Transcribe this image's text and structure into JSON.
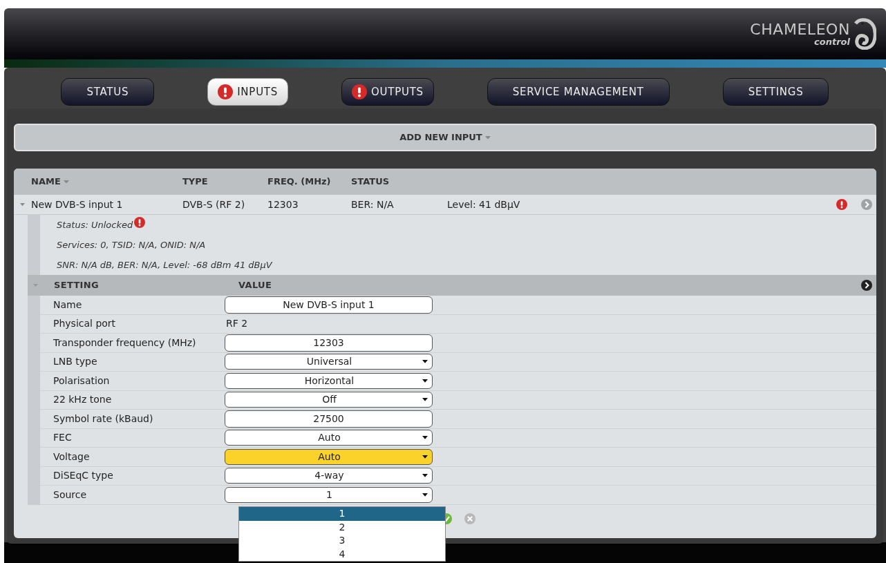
{
  "logo": {
    "brand": "CHAMELEON",
    "product": "control"
  },
  "tabs": [
    {
      "label": "STATUS",
      "selected": false,
      "alert": false
    },
    {
      "label": "INPUTS",
      "selected": true,
      "alert": true
    },
    {
      "label": "OUTPUTS",
      "selected": false,
      "alert": true
    },
    {
      "label": "SERVICE MANAGEMENT",
      "selected": false,
      "alert": false
    },
    {
      "label": "SETTINGS",
      "selected": false,
      "alert": false
    }
  ],
  "add_button": "ADD NEW INPUT",
  "table": {
    "columns": [
      "NAME",
      "TYPE",
      "FREQ. (MHz)",
      "STATUS"
    ],
    "rows": [
      {
        "expanded": true,
        "alert": true,
        "name": "New DVB-S input 1",
        "type": "DVB-S (RF 2)",
        "freq": "12303",
        "ber": "BER: N/A",
        "level": "Level: 41 dBµV",
        "details": [
          {
            "text": "Status: Unlocked",
            "alert": true
          },
          {
            "text": "Services: 0, TSID: N/A, ONID: N/A",
            "alert": false
          },
          {
            "text": "SNR: N/A dB, BER: N/A, Level: -68 dBm 41 dBµV",
            "alert": false
          }
        ],
        "settings": {
          "columns": [
            "SETTING",
            "VALUE"
          ],
          "expanded": true,
          "rows": [
            {
              "label": "Name",
              "kind": "input",
              "value": "New DVB-S input 1",
              "highlighted": false
            },
            {
              "label": "Physical port",
              "kind": "text",
              "value": "RF 2",
              "highlighted": false
            },
            {
              "label": "Transponder frequency (MHz)",
              "kind": "input",
              "value": "12303",
              "highlighted": false
            },
            {
              "label": "LNB type",
              "kind": "select",
              "value": "Universal",
              "highlighted": false
            },
            {
              "label": "Polarisation",
              "kind": "select",
              "value": "Horizontal",
              "highlighted": false
            },
            {
              "label": "22 kHz tone",
              "kind": "select",
              "value": "Off",
              "highlighted": false
            },
            {
              "label": "Symbol rate (kBaud)",
              "kind": "input",
              "value": "27500",
              "highlighted": false
            },
            {
              "label": "FEC",
              "kind": "select",
              "value": "Auto",
              "highlighted": false
            },
            {
              "label": "Voltage",
              "kind": "select",
              "value": "Auto",
              "highlighted": true
            },
            {
              "label": "DiSEqC type",
              "kind": "select",
              "value": "4-way",
              "highlighted": false
            },
            {
              "label": "Source",
              "kind": "select",
              "value": "1",
              "highlighted": false
            }
          ]
        }
      }
    ]
  },
  "open_dropdown": {
    "options": [
      {
        "label": "1",
        "selected": true
      },
      {
        "label": "2",
        "selected": false
      },
      {
        "label": "3",
        "selected": false
      },
      {
        "label": "4",
        "selected": false
      }
    ]
  }
}
